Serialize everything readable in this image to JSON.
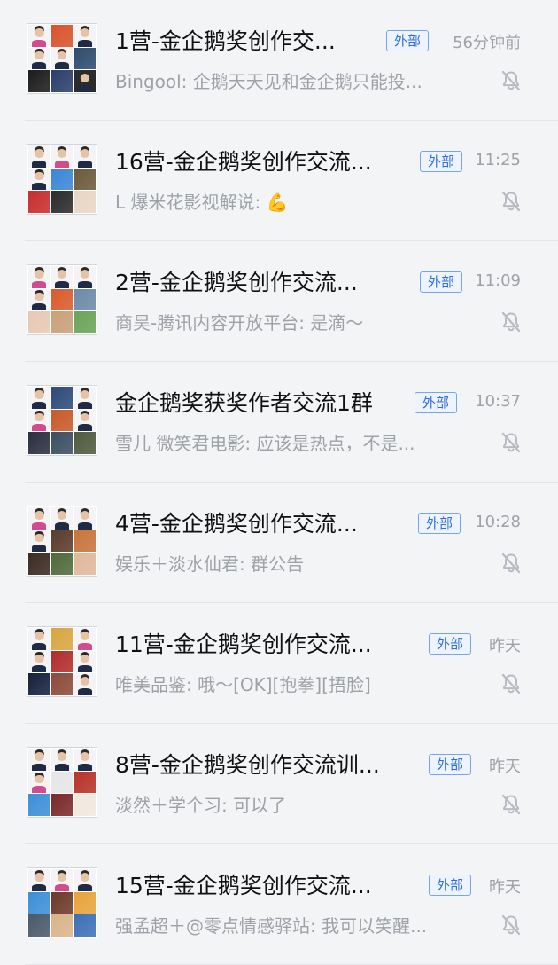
{
  "conversations": [
    {
      "title": "1营-金企鹅奖创作交...",
      "badge": "外部",
      "time": "56分钟前",
      "preview": "Bingool: 企鹅天天见和金企鹅只能投...",
      "avatar_tiles": [
        "person-pink",
        "image:#d9532c",
        "person",
        "person",
        "person",
        "image:#2e4c6e",
        "image:#1c1c1c",
        "image:#2a3f6a",
        "person-dark"
      ]
    },
    {
      "title": "16营-金企鹅奖创作交流...",
      "badge": "外部",
      "time": "11:25",
      "preview": "L 爆米花影视解说: 💪",
      "avatar_tiles": [
        "person",
        "person-pink",
        "person",
        "person",
        "image:#3b86d6",
        "image:#6b5a3a",
        "image:#c92d2d",
        "image:#2b2b2b",
        "image:#e8d6c4"
      ]
    },
    {
      "title": "2营-金企鹅奖创作交流...",
      "badge": "外部",
      "time": "11:09",
      "preview": "商昊-腾讯内容开放平台: 是滴～",
      "avatar_tiles": [
        "person-pink",
        "person",
        "person",
        "person",
        "image:#d95b2c",
        "image:#6c8aa8",
        "image:#e6c9b3",
        "image:#c9a07a",
        "image:#6aa35a"
      ]
    },
    {
      "title": "金企鹅奖获奖作者交流1群",
      "badge": "外部",
      "time": "10:37",
      "preview": "雪儿 微笑君电影: 应该是热点，不是...",
      "avatar_tiles": [
        "person",
        "image:#2d4a7a",
        "person",
        "person-pink",
        "image:#c75a2a",
        "person",
        "image:#2a3040",
        "image:#3b4e63",
        "image:#4f5a3e"
      ]
    },
    {
      "title": "4营-金企鹅奖创作交流...",
      "badge": "外部",
      "time": "10:28",
      "preview": "娱乐＋淡水仙君: 群公告",
      "avatar_tiles": [
        "person-pink",
        "person",
        "person",
        "person",
        "image:#5a3c2a",
        "image:#c8733a",
        "image:#3a2a22",
        "image:#4f6a3a",
        "image:#e0b89a"
      ]
    },
    {
      "title": "11营-金企鹅奖创作交流...",
      "badge": "外部",
      "time": "昨天",
      "preview": "唯美品鉴: 哦～[OK][抱拳][捂脸]",
      "avatar_tiles": [
        "person",
        "image:#d8a640",
        "person-pink",
        "person",
        "image:#b12d2d",
        "person",
        "image:#16213e",
        "image:#8c4a3a",
        "person"
      ]
    },
    {
      "title": "8营-金企鹅奖创作交流训...",
      "badge": "外部",
      "time": "昨天",
      "preview": "淡然＋学个习: 可以了",
      "avatar_tiles": [
        "person",
        "person",
        "person",
        "person-pink",
        "image:#e6e6e6",
        "image:#b8322a",
        "image:#3d8fd8",
        "image:#7a2a2a",
        "image:#efe8dd"
      ]
    },
    {
      "title": "15营-金企鹅奖创作交流...",
      "badge": "外部",
      "time": "昨天",
      "preview": "强孟超＋@零点情感驿站: 我可以笑醒...",
      "avatar_tiles": [
        "person",
        "person-pink",
        "person",
        "image:#3d8fd8",
        "image:#6b3a2a",
        "image:#e8a33a",
        "image:#4a5a6a",
        "image:#d9b48a",
        "image:#3d6fb8"
      ]
    }
  ],
  "icons": {
    "mute": "bell-slash-icon"
  }
}
